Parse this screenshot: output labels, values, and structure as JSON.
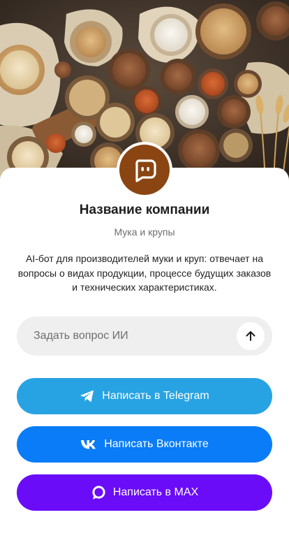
{
  "theme": {
    "avatar_color": "#8B4513",
    "telegram_color": "#27A3E3",
    "vk_color": "#0A7CF7",
    "max_color": "#6A0CF8"
  },
  "hero": {
    "icon": "flour-and-grains-illustration"
  },
  "profile": {
    "avatar_icon": "chat-bot-icon",
    "name": "Название компании",
    "category": "Мука и крупы",
    "description": "AI-бот для производителей муки и круп: отвечает на вопросы о видах продукции, процессе будущих заказов и технических характеристиках."
  },
  "ask": {
    "placeholder": "Задать вопрос ИИ",
    "value": "",
    "send_icon": "arrow-up-icon"
  },
  "actions": [
    {
      "label": "Написать в Telegram",
      "icon": "telegram-icon"
    },
    {
      "label": "Написать Вконтакте",
      "icon": "vk-icon"
    },
    {
      "label": "Написать в MAX",
      "icon": "max-icon"
    }
  ]
}
